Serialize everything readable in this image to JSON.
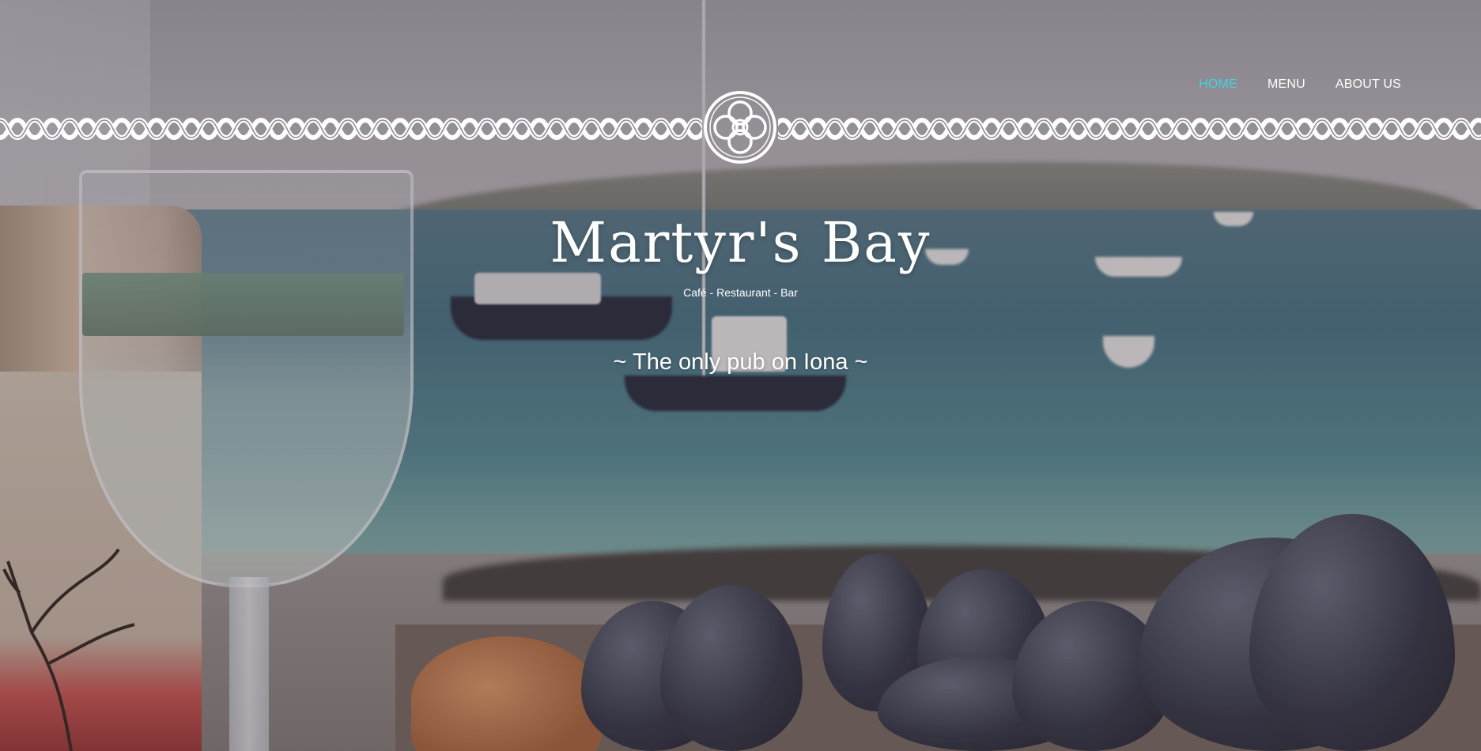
{
  "nav": {
    "items": [
      {
        "label": "HOME",
        "active": true
      },
      {
        "label": "MENU",
        "active": false
      },
      {
        "label": "ABOUT US",
        "active": false
      }
    ],
    "active_color": "#3fd5e3"
  },
  "hero": {
    "title": "Martyr's Bay",
    "subtitle": "Café - Restaurant - Bar",
    "tagline": "~ The only pub on Iona ~"
  },
  "icons": {
    "band": "celtic-knot-band-icon",
    "emblem": "celtic-knot-emblem-icon"
  }
}
